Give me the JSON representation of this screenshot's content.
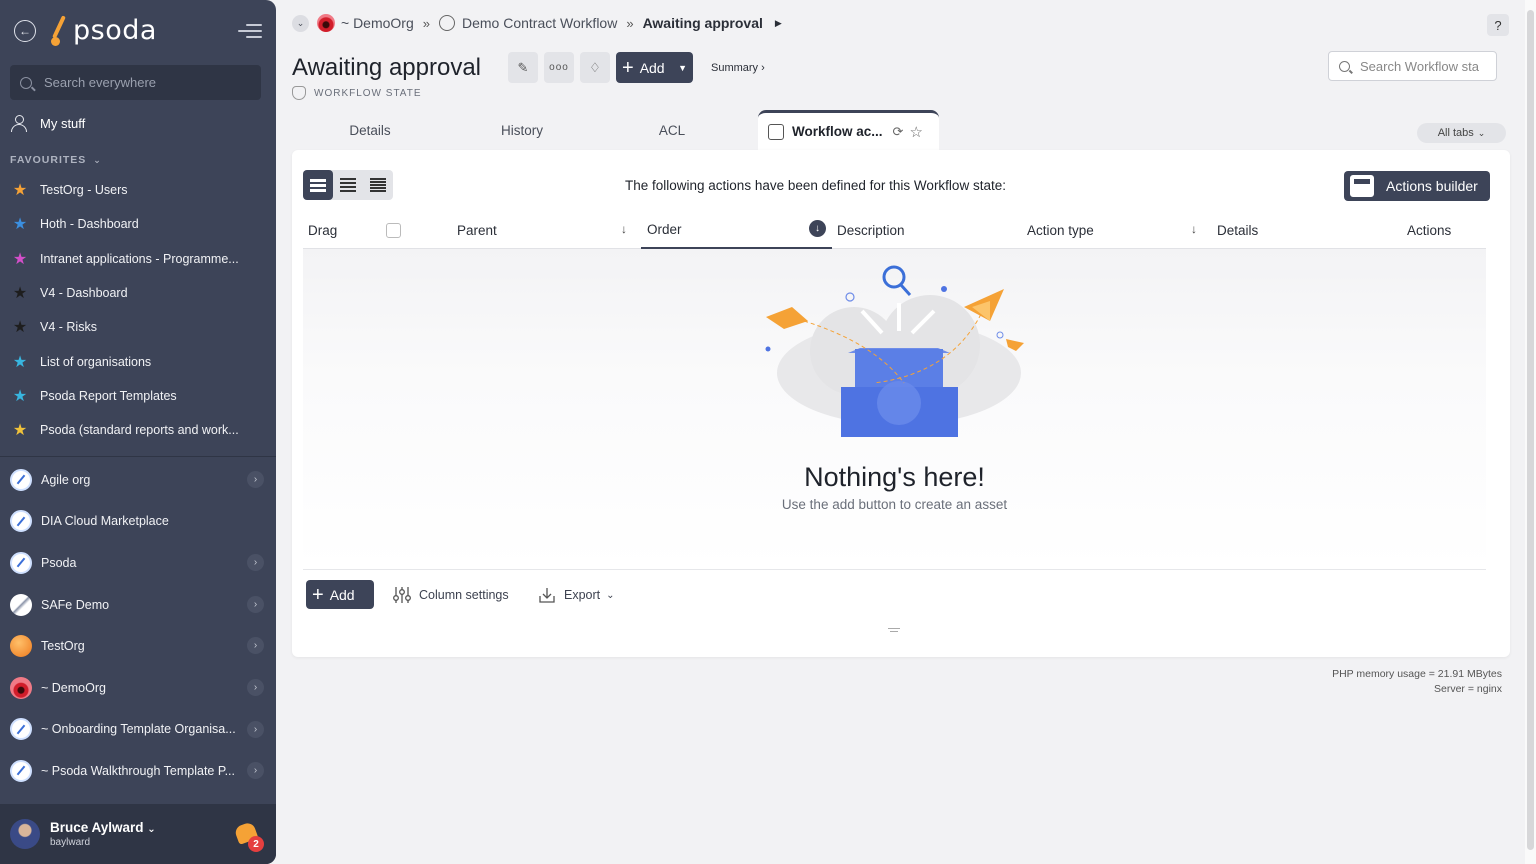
{
  "sidebar": {
    "logo_text": "psoda",
    "search_placeholder": "Search everywhere",
    "my_stuff": "My stuff",
    "favourites_heading": "FAVOURITES",
    "favourites": [
      {
        "label": "TestOrg - Users",
        "color": "#f5a236"
      },
      {
        "label": "Hoth - Dashboard",
        "color": "#3b8fe0"
      },
      {
        "label": "Intranet applications - Programme...",
        "color": "#d34fc9"
      },
      {
        "label": "V4 - Dashboard",
        "color": "#1e1e1e"
      },
      {
        "label": "V4 - Risks",
        "color": "#1e1e1e"
      },
      {
        "label": "List of organisations",
        "color": "#38b6e0"
      },
      {
        "label": "Psoda Report Templates",
        "color": "#38b6e0"
      },
      {
        "label": "Psoda (standard reports and work...",
        "color": "#f0c23a"
      }
    ],
    "orgs": [
      {
        "label": "Agile org",
        "icon": "compass",
        "chevron": true
      },
      {
        "label": "DIA Cloud Marketplace",
        "icon": "compass",
        "chevron": false
      },
      {
        "label": "Psoda",
        "icon": "compass",
        "chevron": true
      },
      {
        "label": "SAFe Demo",
        "icon": "safe",
        "chevron": true
      },
      {
        "label": "TestOrg",
        "icon": "orange",
        "chevron": true
      },
      {
        "label": "~ DemoOrg",
        "icon": "red",
        "chevron": true
      },
      {
        "label": "~ Onboarding Template Organisa...",
        "icon": "compass",
        "chevron": true
      },
      {
        "label": "~ Psoda Walkthrough Template P...",
        "icon": "compass",
        "chevron": true
      }
    ],
    "user": {
      "name": "Bruce Aylward",
      "username": "baylward",
      "notifications": "2"
    }
  },
  "breadcrumb": {
    "org": "~ DemoOrg",
    "workflow": "Demo Contract Workflow",
    "current": "Awaiting approval"
  },
  "header": {
    "help": "?",
    "title": "Awaiting approval",
    "add_label": "Add",
    "summary_label": "Summary ›",
    "subtitle": "WORKFLOW STATE",
    "search_placeholder": "Search Workflow sta"
  },
  "tabs": {
    "items": [
      "Details",
      "History",
      "ACL"
    ],
    "active": "Workflow ac...",
    "all_tabs": "All tabs"
  },
  "card": {
    "intro": "The following actions have been defined for this Workflow state:",
    "actions_builder": "Actions builder",
    "columns": {
      "drag": "Drag",
      "parent": "Parent",
      "order": "Order",
      "description": "Description",
      "action_type": "Action type",
      "details": "Details",
      "actions": "Actions"
    },
    "empty_title": "Nothing's here!",
    "empty_sub": "Use the add button to create an asset",
    "footer": {
      "add": "Add",
      "column_settings": "Column settings",
      "export": "Export"
    }
  },
  "server_info": {
    "memory": "PHP memory usage = 21.91 MBytes",
    "server": "Server = nginx"
  }
}
